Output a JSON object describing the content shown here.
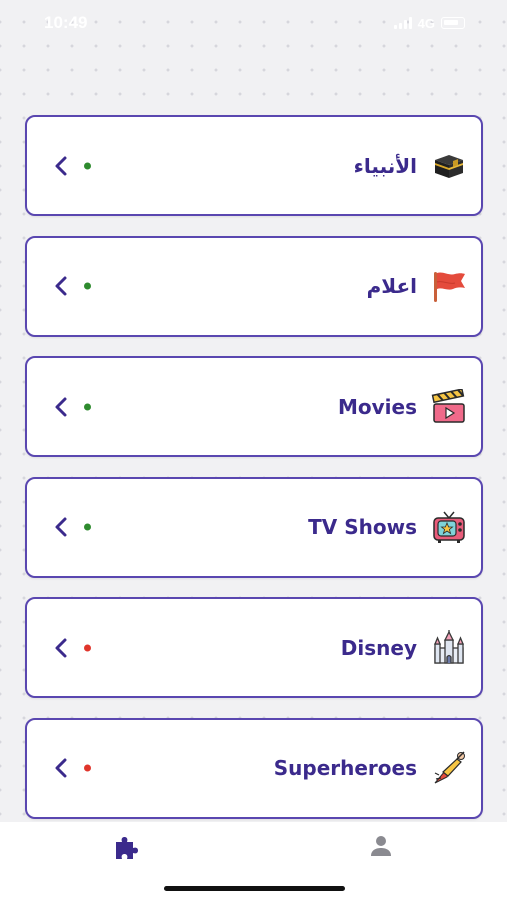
{
  "status_bar": {
    "time": "10:49",
    "network": "4G"
  },
  "categories": [
    {
      "label": "الأنبياء",
      "icon": "kaaba-icon",
      "dot_color": "#2e8b2e"
    },
    {
      "label": "اعلام",
      "icon": "flag-icon",
      "dot_color": "#2e8b2e"
    },
    {
      "label": "Movies",
      "icon": "clapperboard-icon",
      "dot_color": "#2e8b2e"
    },
    {
      "label": "TV Shows",
      "icon": "retro-tv-icon",
      "dot_color": "#2e8b2e"
    },
    {
      "label": "Disney",
      "icon": "castle-icon",
      "dot_color": "#e0352b"
    },
    {
      "label": "Superheroes",
      "icon": "superhero-icon",
      "dot_color": "#e0352b"
    }
  ],
  "bottom_nav": [
    {
      "icon": "puzzle-icon",
      "active": true
    },
    {
      "icon": "user-icon",
      "active": false
    }
  ],
  "colors": {
    "accent": "#3b2a8c",
    "card_border": "#5a47b0",
    "inactive_tab": "#8a8a90"
  }
}
